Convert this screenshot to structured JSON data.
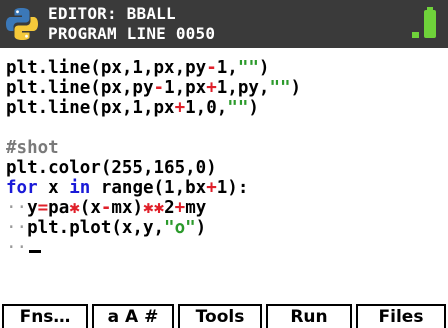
{
  "header": {
    "title_line1": "EDITOR: BBALL",
    "title_line2": "PROGRAM LINE 0050",
    "logo_icon": "python-icon",
    "battery_icon": "battery-icon",
    "colors": {
      "bar": "#3a3a3a",
      "battery": "#6fd33a"
    }
  },
  "code": {
    "line1": {
      "a": "plt.line(px,1,px,py",
      "b": "-",
      "c": "1,",
      "d": "\"\"",
      "e": ")"
    },
    "line2": {
      "a": "plt.line(px,py",
      "b": "-",
      "c": "1,px",
      "d": "+",
      "e": "1,py,",
      "f": "\"\"",
      "g": ")"
    },
    "line3": {
      "a": "plt.line(px,1,px",
      "b": "+",
      "c": "1,0,",
      "d": "\"\"",
      "e": ")"
    },
    "comment": "#shot",
    "line5": "plt.color(255,165,0)",
    "line6": {
      "kw_for": "for",
      "a": " x ",
      "kw_in": "in",
      "b": " range(1,bx",
      "c": "+",
      "d": "1):"
    },
    "line7": {
      "indent": "··",
      "a": "y",
      "b": "=",
      "c": "pa",
      "d": "✱",
      "e": "(x",
      "f": "-",
      "g": "mx)",
      "h": "✱✱",
      "i": "2",
      "j": "+",
      "k": "my"
    },
    "line8": {
      "indent": "··",
      "a": "plt.plot(x,y,",
      "b": "\"o\"",
      "c": ")"
    },
    "line9": {
      "indent": "··"
    },
    "syntax_colors": {
      "keyword": "#1a1ad8",
      "string": "#2b9a2b",
      "operator": "#e0202a",
      "comment": "#7a7a7a"
    }
  },
  "menu": {
    "fns": "Fns…",
    "chars": "a A #",
    "tools": "Tools",
    "run": "Run",
    "files": "Files"
  }
}
